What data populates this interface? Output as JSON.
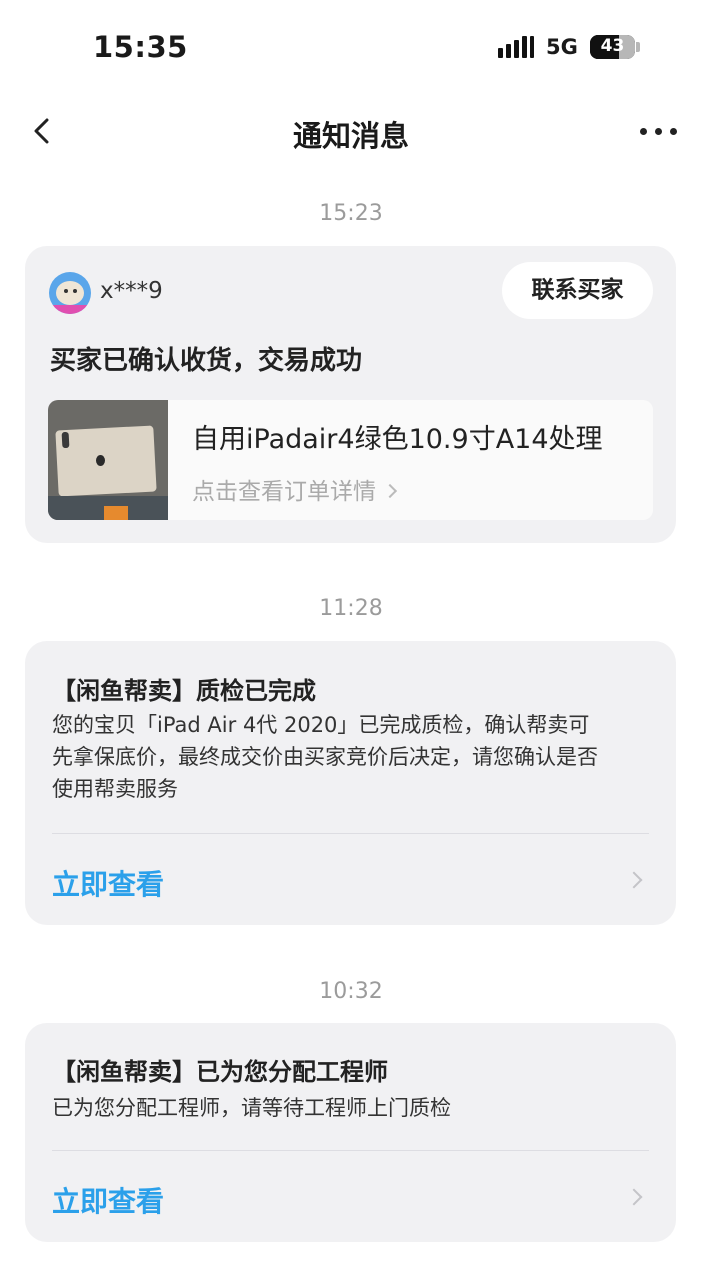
{
  "status_bar": {
    "time": "15:35",
    "network": "5G",
    "battery": "43"
  },
  "nav": {
    "title": "通知消息"
  },
  "messages": [
    {
      "timestamp": "15:23",
      "buyer_name": "x***9",
      "contact_label": "联系买家",
      "title": "买家已确认收货，交易成功",
      "product_name": "自用iPadair4绿色10.9寸A14处理",
      "product_link": "点击查看订单详情"
    },
    {
      "timestamp": "11:28",
      "title": "【闲鱼帮卖】质检已完成",
      "body_lines": [
        "您的宝贝「iPad Air 4代 2020」已完成质检，确认帮卖可",
        "先拿保底价，最终成交价由买家竞价后决定，请您确认是否",
        "使用帮卖服务"
      ],
      "action": "立即查看"
    },
    {
      "timestamp": "10:32",
      "title": "【闲鱼帮卖】已为您分配工程师",
      "body_lines": [
        "已为您分配工程师，请等待工程师上门质检"
      ],
      "action": "立即查看"
    }
  ],
  "colors": {
    "accent": "#2ba0ea",
    "card_bg": "#f1f1f3",
    "timestamp": "#9b9b9b"
  }
}
